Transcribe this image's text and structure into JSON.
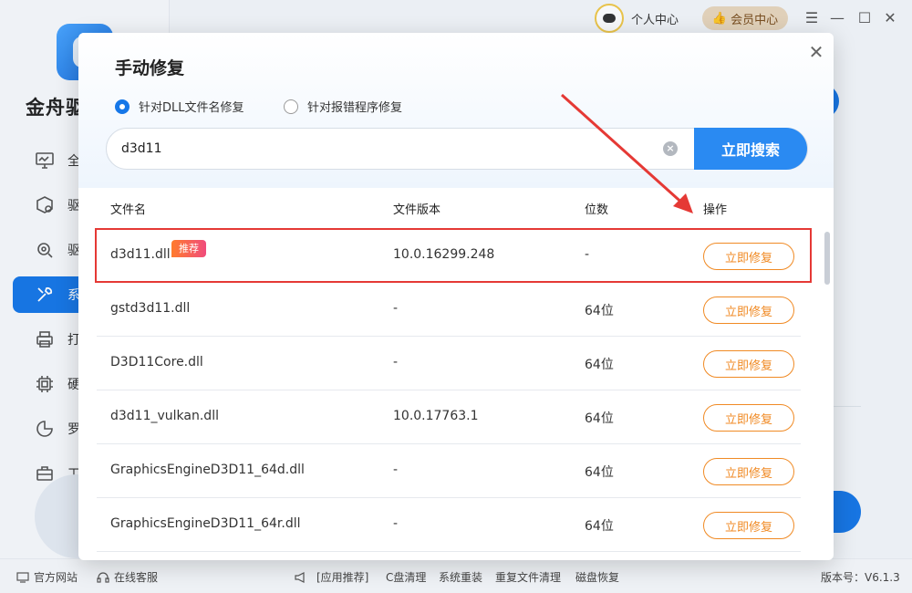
{
  "app": {
    "title": "金舟驱",
    "nav": [
      {
        "label": "全",
        "icon": "monitor-icon"
      },
      {
        "label": "驱",
        "icon": "box-gear-icon"
      },
      {
        "label": "驱",
        "icon": "gear-search-icon"
      },
      {
        "label": "系",
        "icon": "wrench-icon",
        "active": true
      },
      {
        "label": "打",
        "icon": "printer-icon"
      },
      {
        "label": "硬",
        "icon": "chip-icon"
      },
      {
        "label": "罗",
        "icon": "gamepad-icon"
      },
      {
        "label": "工",
        "icon": "toolbox-icon"
      }
    ],
    "top": {
      "user_center": "个人中心",
      "vip": "会员中心"
    }
  },
  "statusbar": {
    "official_site": "官方网站",
    "online_service": "在线客服",
    "recommend": "[应用推荐]",
    "links": [
      "C盘清理",
      "系统重装",
      "重复文件清理",
      "磁盘恢复"
    ],
    "version": "版本号：V6.1.3"
  },
  "dialog": {
    "title": "手动修复",
    "radio_dll": "针对DLL文件名修复",
    "radio_error": "针对报错程序修复",
    "search_value": "d3d11",
    "search_button": "立即搜索",
    "headers": {
      "filename": "文件名",
      "version": "文件版本",
      "bits": "位数",
      "action": "操作"
    },
    "repair_label": "立即修复",
    "recommend_tag": "推荐",
    "rows": [
      {
        "name": "d3d11.dll",
        "version": "10.0.16299.248",
        "bits": "-"
      },
      {
        "name": "gstd3d11.dll",
        "version": "-",
        "bits": "64位"
      },
      {
        "name": "D3D11Core.dll",
        "version": "-",
        "bits": "64位"
      },
      {
        "name": "d3d11_vulkan.dll",
        "version": "10.0.17763.1",
        "bits": "64位"
      },
      {
        "name": "GraphicsEngineD3D11_64d.dll",
        "version": "-",
        "bits": "64位"
      },
      {
        "name": "GraphicsEngineD3D11_64r.dll",
        "version": "-",
        "bits": "64位"
      }
    ]
  },
  "colors": {
    "primary": "#1677e8",
    "accent": "#f08a24",
    "highlight": "#e53935"
  }
}
